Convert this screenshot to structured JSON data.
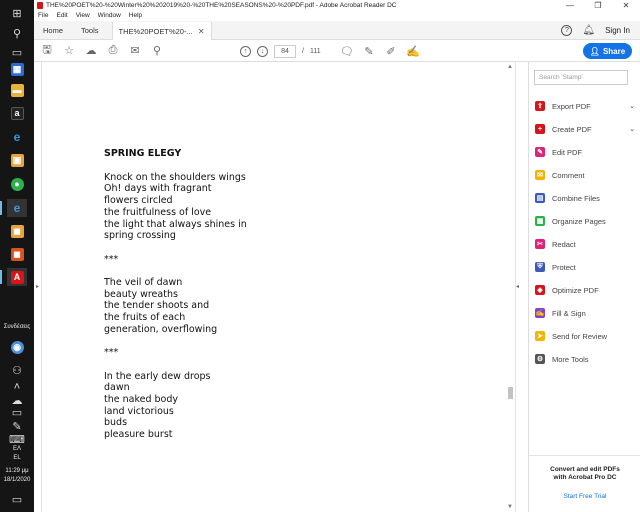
{
  "taskbar": {
    "language_label": "Συνδέσεις",
    "keyboard_lang": "ΕΛ",
    "keyboard_lang2": "EL",
    "time": "11:29 μμ",
    "date": "18/1/2020"
  },
  "window": {
    "title": "THE%20POET%20-%20Winter%20%202019%20-%20THE%20SEASONS%20-%20PDF.pdf - Adobe Acrobat Reader DC",
    "menu": [
      "File",
      "Edit",
      "View",
      "Window",
      "Help"
    ]
  },
  "tabs": {
    "home": "Home",
    "tools": "Tools",
    "document": "THE%20POET%20-...",
    "sign_in": "Sign In"
  },
  "toolbar": {
    "current_page": "84",
    "separator": "/",
    "total_pages": "111",
    "share_label": "Share"
  },
  "document": {
    "heading": "SPRING ELEGY",
    "stanzas": [
      [
        "Knock on the shoulders wings",
        "Oh! days with fragrant",
        "flowers circled",
        "the fruitfulness of love",
        "the light that always shines in",
        "spring crossing"
      ],
      [
        "***"
      ],
      [
        "The veil of dawn",
        "beauty wreaths",
        "the tender shoots and",
        "the fruits of each",
        "generation, overflowing"
      ],
      [
        "***"
      ],
      [
        "In the early dew drops",
        "dawn",
        "the naked body",
        "land victorious",
        "buds",
        "pleasure burst"
      ]
    ]
  },
  "tools_pane": {
    "search_placeholder": "Search 'Stamp'",
    "items": [
      {
        "label": "Export PDF",
        "icon": "export-pdf-icon",
        "color": "#d4161b",
        "expandable": true
      },
      {
        "label": "Create PDF",
        "icon": "create-pdf-icon",
        "color": "#d4161b",
        "expandable": true
      },
      {
        "label": "Edit PDF",
        "icon": "edit-pdf-icon",
        "color": "#e0227a",
        "expandable": false
      },
      {
        "label": "Comment",
        "icon": "comment-icon",
        "color": "#f5b400",
        "expandable": false
      },
      {
        "label": "Combine Files",
        "icon": "combine-files-icon",
        "color": "#3c5ab8",
        "expandable": false
      },
      {
        "label": "Organize Pages",
        "icon": "organize-pages-icon",
        "color": "#2bb24c",
        "expandable": false
      },
      {
        "label": "Redact",
        "icon": "redact-icon",
        "color": "#e0227a",
        "expandable": false
      },
      {
        "label": "Protect",
        "icon": "protect-icon",
        "color": "#3c5ab8",
        "expandable": false
      },
      {
        "label": "Optimize PDF",
        "icon": "optimize-pdf-icon",
        "color": "#d4161b",
        "expandable": false
      },
      {
        "label": "Fill & Sign",
        "icon": "fill-sign-icon",
        "color": "#8a3fc8",
        "expandable": false
      },
      {
        "label": "Send for Review",
        "icon": "send-for-review-icon",
        "color": "#f5b400",
        "expandable": false
      },
      {
        "label": "More Tools",
        "icon": "more-tools-icon",
        "color": "#555555",
        "expandable": false
      }
    ],
    "promo_line1": "Convert and edit PDFs",
    "promo_line2": "with Acrobat Pro DC",
    "promo_link": "Start Free Trial"
  }
}
